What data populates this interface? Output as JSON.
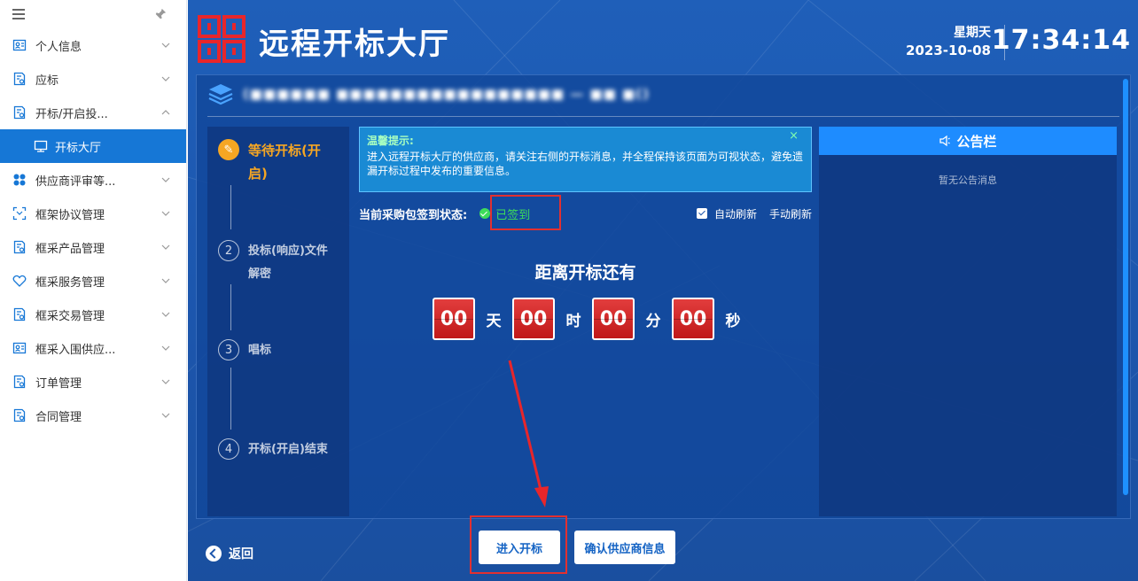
{
  "sidebar": {
    "items": [
      {
        "label": "个人信息",
        "icon": "person-card-icon"
      },
      {
        "label": "应标",
        "icon": "document-seal-icon"
      },
      {
        "label": "开标/开启投...",
        "icon": "document-seal-icon"
      },
      {
        "label": "开标大厅",
        "icon": "monitor-icon"
      },
      {
        "label": "供应商评审等...",
        "icon": "grid-dots-icon"
      },
      {
        "label": "框架协议管理",
        "icon": "frame-icon"
      },
      {
        "label": "框采产品管理",
        "icon": "document-seal-icon"
      },
      {
        "label": "框采服务管理",
        "icon": "heart-icon"
      },
      {
        "label": "框采交易管理",
        "icon": "document-seal-icon"
      },
      {
        "label": "框采入围供应...",
        "icon": "person-card-icon"
      },
      {
        "label": "订单管理",
        "icon": "document-seal-icon"
      },
      {
        "label": "合同管理",
        "icon": "document-seal-icon"
      }
    ]
  },
  "header": {
    "title": "远程开标大厅",
    "weekday": "星期天",
    "date": "2023-10-08",
    "time": "17:34:14"
  },
  "project": {
    "title_blurred": "(■■■■■■ ■■■■■■■■■■■■■■■■■ — ■■ ■()"
  },
  "steps": [
    {
      "num": "✎",
      "label": "等待开标(开启)"
    },
    {
      "num": "2",
      "label": "投标(响应)文件解密"
    },
    {
      "num": "3",
      "label": "唱标"
    },
    {
      "num": "4",
      "label": "开标(开启)结束"
    }
  ],
  "tip": {
    "title": "温馨提示:",
    "body": "进入远程开标大厅的供应商，请关注右侧的开标消息，并全程保持该页面为可视状态，避免遗漏开标过程中发布的重要信息。",
    "close": "×"
  },
  "status": {
    "label": "当前采购包签到状态:",
    "value": "已签到",
    "auto_refresh": "自动刷新",
    "manual_refresh": "手动刷新"
  },
  "countdown": {
    "title": "距离开标还有",
    "days": "00",
    "days_unit": "天",
    "hours": "00",
    "hours_unit": "时",
    "minutes": "00",
    "minutes_unit": "分",
    "seconds": "00",
    "seconds_unit": "秒"
  },
  "bulletin": {
    "title": "公告栏",
    "empty": "暂无公告消息"
  },
  "footer": {
    "back": "返回",
    "enter": "进入开标",
    "confirm": "确认供应商信息"
  },
  "colors": {
    "accent": "#1677d6",
    "active_step": "#f5a623",
    "signed": "#3ddc5a",
    "highlight": "#e23030",
    "countdown_box": "#d42a2a"
  }
}
